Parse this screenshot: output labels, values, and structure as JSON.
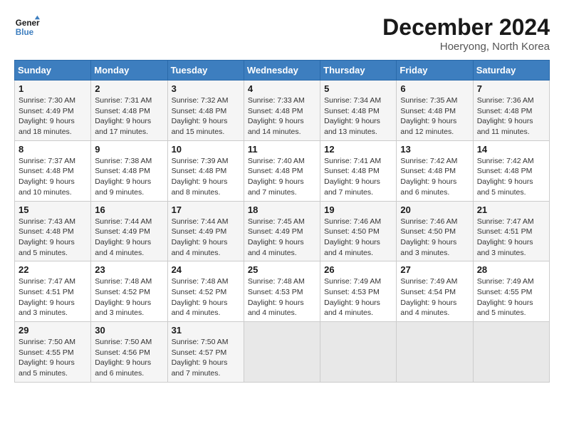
{
  "header": {
    "logo_line1": "General",
    "logo_line2": "Blue",
    "month": "December 2024",
    "location": "Hoeryong, North Korea"
  },
  "weekdays": [
    "Sunday",
    "Monday",
    "Tuesday",
    "Wednesday",
    "Thursday",
    "Friday",
    "Saturday"
  ],
  "weeks": [
    [
      {
        "day": "1",
        "info": "Sunrise: 7:30 AM\nSunset: 4:49 PM\nDaylight: 9 hours and 18 minutes."
      },
      {
        "day": "2",
        "info": "Sunrise: 7:31 AM\nSunset: 4:48 PM\nDaylight: 9 hours and 17 minutes."
      },
      {
        "day": "3",
        "info": "Sunrise: 7:32 AM\nSunset: 4:48 PM\nDaylight: 9 hours and 15 minutes."
      },
      {
        "day": "4",
        "info": "Sunrise: 7:33 AM\nSunset: 4:48 PM\nDaylight: 9 hours and 14 minutes."
      },
      {
        "day": "5",
        "info": "Sunrise: 7:34 AM\nSunset: 4:48 PM\nDaylight: 9 hours and 13 minutes."
      },
      {
        "day": "6",
        "info": "Sunrise: 7:35 AM\nSunset: 4:48 PM\nDaylight: 9 hours and 12 minutes."
      },
      {
        "day": "7",
        "info": "Sunrise: 7:36 AM\nSunset: 4:48 PM\nDaylight: 9 hours and 11 minutes."
      }
    ],
    [
      {
        "day": "8",
        "info": "Sunrise: 7:37 AM\nSunset: 4:48 PM\nDaylight: 9 hours and 10 minutes."
      },
      {
        "day": "9",
        "info": "Sunrise: 7:38 AM\nSunset: 4:48 PM\nDaylight: 9 hours and 9 minutes."
      },
      {
        "day": "10",
        "info": "Sunrise: 7:39 AM\nSunset: 4:48 PM\nDaylight: 9 hours and 8 minutes."
      },
      {
        "day": "11",
        "info": "Sunrise: 7:40 AM\nSunset: 4:48 PM\nDaylight: 9 hours and 7 minutes."
      },
      {
        "day": "12",
        "info": "Sunrise: 7:41 AM\nSunset: 4:48 PM\nDaylight: 9 hours and 7 minutes."
      },
      {
        "day": "13",
        "info": "Sunrise: 7:42 AM\nSunset: 4:48 PM\nDaylight: 9 hours and 6 minutes."
      },
      {
        "day": "14",
        "info": "Sunrise: 7:42 AM\nSunset: 4:48 PM\nDaylight: 9 hours and 5 minutes."
      }
    ],
    [
      {
        "day": "15",
        "info": "Sunrise: 7:43 AM\nSunset: 4:48 PM\nDaylight: 9 hours and 5 minutes."
      },
      {
        "day": "16",
        "info": "Sunrise: 7:44 AM\nSunset: 4:49 PM\nDaylight: 9 hours and 4 minutes."
      },
      {
        "day": "17",
        "info": "Sunrise: 7:44 AM\nSunset: 4:49 PM\nDaylight: 9 hours and 4 minutes."
      },
      {
        "day": "18",
        "info": "Sunrise: 7:45 AM\nSunset: 4:49 PM\nDaylight: 9 hours and 4 minutes."
      },
      {
        "day": "19",
        "info": "Sunrise: 7:46 AM\nSunset: 4:50 PM\nDaylight: 9 hours and 4 minutes."
      },
      {
        "day": "20",
        "info": "Sunrise: 7:46 AM\nSunset: 4:50 PM\nDaylight: 9 hours and 3 minutes."
      },
      {
        "day": "21",
        "info": "Sunrise: 7:47 AM\nSunset: 4:51 PM\nDaylight: 9 hours and 3 minutes."
      }
    ],
    [
      {
        "day": "22",
        "info": "Sunrise: 7:47 AM\nSunset: 4:51 PM\nDaylight: 9 hours and 3 minutes."
      },
      {
        "day": "23",
        "info": "Sunrise: 7:48 AM\nSunset: 4:52 PM\nDaylight: 9 hours and 3 minutes."
      },
      {
        "day": "24",
        "info": "Sunrise: 7:48 AM\nSunset: 4:52 PM\nDaylight: 9 hours and 4 minutes."
      },
      {
        "day": "25",
        "info": "Sunrise: 7:48 AM\nSunset: 4:53 PM\nDaylight: 9 hours and 4 minutes."
      },
      {
        "day": "26",
        "info": "Sunrise: 7:49 AM\nSunset: 4:53 PM\nDaylight: 9 hours and 4 minutes."
      },
      {
        "day": "27",
        "info": "Sunrise: 7:49 AM\nSunset: 4:54 PM\nDaylight: 9 hours and 4 minutes."
      },
      {
        "day": "28",
        "info": "Sunrise: 7:49 AM\nSunset: 4:55 PM\nDaylight: 9 hours and 5 minutes."
      }
    ],
    [
      {
        "day": "29",
        "info": "Sunrise: 7:50 AM\nSunset: 4:55 PM\nDaylight: 9 hours and 5 minutes."
      },
      {
        "day": "30",
        "info": "Sunrise: 7:50 AM\nSunset: 4:56 PM\nDaylight: 9 hours and 6 minutes."
      },
      {
        "day": "31",
        "info": "Sunrise: 7:50 AM\nSunset: 4:57 PM\nDaylight: 9 hours and 7 minutes."
      },
      {
        "day": "",
        "info": ""
      },
      {
        "day": "",
        "info": ""
      },
      {
        "day": "",
        "info": ""
      },
      {
        "day": "",
        "info": ""
      }
    ]
  ]
}
